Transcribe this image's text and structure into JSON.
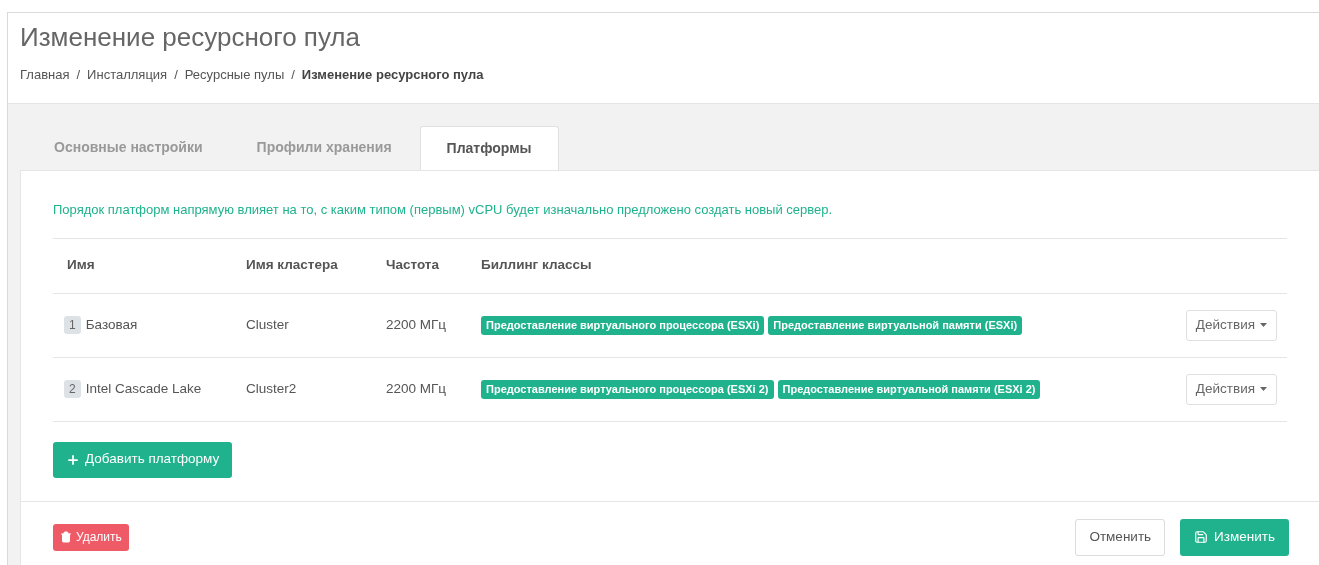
{
  "page_title": "Изменение ресурсного пула",
  "breadcrumbs": [
    {
      "label": "Главная",
      "current": false
    },
    {
      "label": "Инсталляция",
      "current": false
    },
    {
      "label": "Ресурсные пулы",
      "current": false
    },
    {
      "label": "Изменение ресурсного пула",
      "current": true
    }
  ],
  "breadcrumb_separator": "/",
  "tabs": [
    {
      "label": "Основные настройки",
      "selected": false
    },
    {
      "label": "Профили хранения",
      "selected": false
    },
    {
      "label": "Платформы",
      "selected": true
    }
  ],
  "notice": "Порядок платформ напрямую влияет на то, с каким типом (первым) vCPU будет изначально предложено создать новый сервер.",
  "table": {
    "columns": [
      "Имя",
      "Имя кластера",
      "Частота",
      "Биллинг классы"
    ],
    "rows": [
      {
        "order": "1",
        "name": "Базовая",
        "cluster": "Cluster",
        "frequency": "2200 МГц",
        "billing_classes": [
          "Предоставление виртуального процессора (ESXi)",
          "Предоставление виртуальной памяти (ESXi)"
        ],
        "action": "Действия"
      },
      {
        "order": "2",
        "name": "Intel Cascade Lake",
        "cluster": "Cluster2",
        "frequency": "2200 МГц",
        "billing_classes": [
          "Предоставление виртуального процессора (ESXi 2)",
          "Предоставление виртуальной памяти (ESXi 2)"
        ],
        "action": "Действия"
      }
    ]
  },
  "add_button": "Добавить платформу",
  "footer": {
    "delete_button": "Удалить",
    "cancel_button": "Отменить",
    "save_button": "Изменить"
  }
}
